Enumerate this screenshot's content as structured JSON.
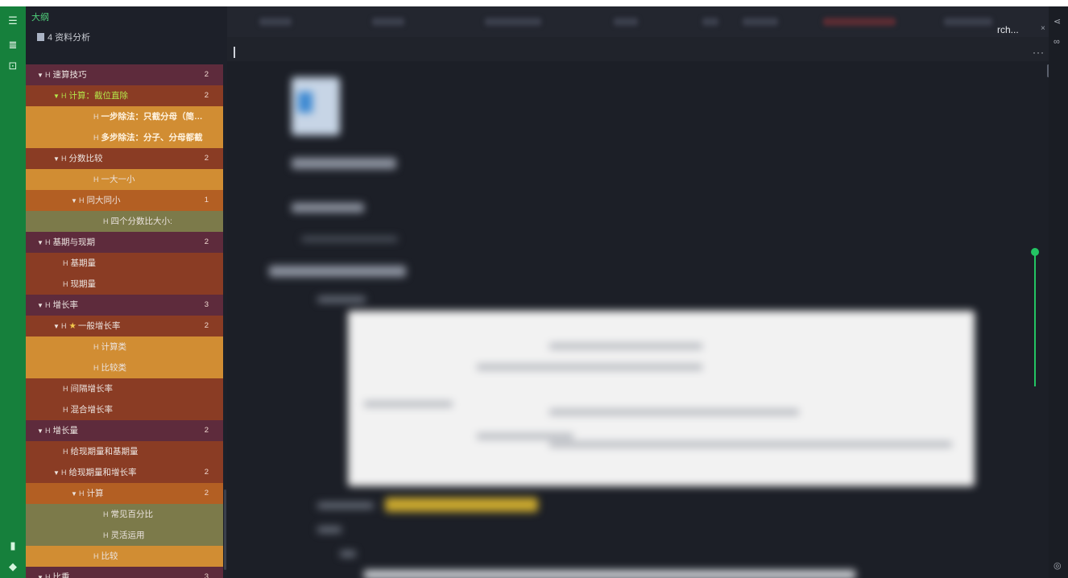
{
  "sidebar_dock": {
    "icons": [
      "list-icon",
      "outline-icon",
      "inbox-icon",
      "bookmark-icon",
      "tag-icon"
    ]
  },
  "outline": {
    "title": "大纲",
    "document": "4 资料分析",
    "items": [
      {
        "text": "速算技巧",
        "level": 0,
        "collapsible": true,
        "count": "2"
      },
      {
        "text": "计算：截位直除",
        "level": 1,
        "collapsible": true,
        "count": "2",
        "highlighted": true
      },
      {
        "text": "一步除法：只截分母（简…",
        "level": 3,
        "collapsible": false,
        "bold": true
      },
      {
        "text": "多步除法：分子、分母都截",
        "level": 3,
        "collapsible": false,
        "bold": true
      },
      {
        "text": "分数比较",
        "level": 1,
        "collapsible": true,
        "count": "2"
      },
      {
        "text": "一大一小",
        "level": 3,
        "collapsible": false
      },
      {
        "text": "同大同小",
        "level": 2,
        "collapsible": true,
        "count": "1"
      },
      {
        "text": "四个分数比大小:",
        "level": 4,
        "collapsible": false
      },
      {
        "text": "基期与现期",
        "level": 0,
        "collapsible": true,
        "count": "2"
      },
      {
        "text": "基期量",
        "level": 1,
        "collapsible": false
      },
      {
        "text": "现期量",
        "level": 1,
        "collapsible": false
      },
      {
        "text": "增长率",
        "level": 0,
        "collapsible": true,
        "count": "3"
      },
      {
        "text": "一般增长率",
        "level": 1,
        "collapsible": true,
        "count": "2",
        "star": true
      },
      {
        "text": "计算类",
        "level": 3,
        "collapsible": false
      },
      {
        "text": "比较类",
        "level": 3,
        "collapsible": false
      },
      {
        "text": "间隔增长率",
        "level": 1,
        "collapsible": false
      },
      {
        "text": "混合增长率",
        "level": 1,
        "collapsible": false
      },
      {
        "text": "增长量",
        "level": 0,
        "collapsible": true,
        "count": "2"
      },
      {
        "text": "给现期量和基期量",
        "level": 1,
        "collapsible": false
      },
      {
        "text": "给现期量和增长率",
        "level": 1,
        "collapsible": true,
        "count": "2"
      },
      {
        "text": "计算",
        "level": 2,
        "collapsible": true,
        "count": "2"
      },
      {
        "text": "常见百分比",
        "level": 4,
        "collapsible": false
      },
      {
        "text": "灵活运用",
        "level": 4,
        "collapsible": false
      },
      {
        "text": "比较",
        "level": 3,
        "collapsible": false
      },
      {
        "text": "比重",
        "level": 0,
        "collapsible": true,
        "count": "3"
      }
    ]
  },
  "editor": {
    "tab_search_label": "rch...",
    "tab_close": "×",
    "more_label": "···"
  },
  "colors": {
    "dock": "#16803c",
    "level0": "#5e2b3c",
    "level1": "#8a3c24",
    "level2": "#b35f23",
    "level3": "#d18d33",
    "level4": "#7c7a4a",
    "accent": "#23c463"
  }
}
